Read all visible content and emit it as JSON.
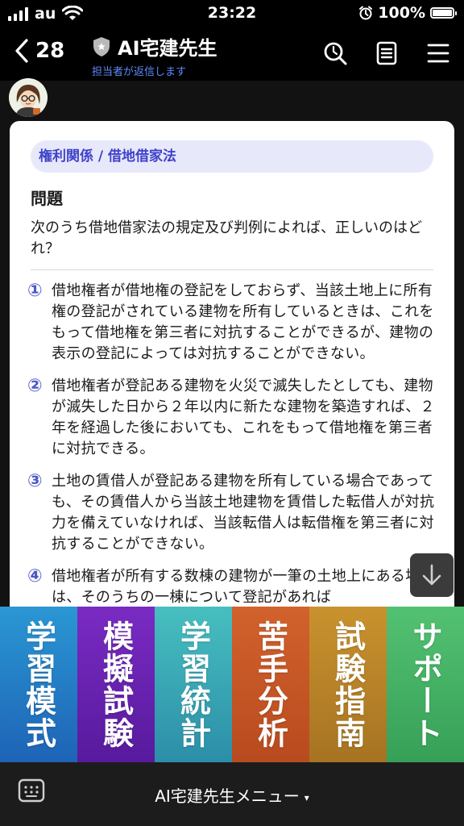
{
  "status_bar": {
    "carrier": "au",
    "time": "23:22",
    "battery": "100%"
  },
  "header": {
    "back_count": "28",
    "title": "AI宅建先生",
    "subtitle": "担当者が返信します"
  },
  "card": {
    "category": "権利関係 / 借地借家法",
    "question_heading": "問題",
    "question_text": "次のうち借地借家法の規定及び判例によれば、正しいのはどれ？",
    "options": [
      {
        "number": "①",
        "text": "借地権者が借地権の登記をしておらず、当該土地上に所有権の登記がされている建物を所有しているときは、これをもって借地権を第三者に対抗することができるが、建物の表示の登記によっては対抗することができない。"
      },
      {
        "number": "②",
        "text": "借地権者が登記ある建物を火災で滅失したとしても、建物が滅失した日から２年以内に新たな建物を築造すれば、２年を経過した後においても、これをもって借地権を第三者に対抗できる。"
      },
      {
        "number": "③",
        "text": "土地の賃借人が登記ある建物を所有している場合であっても、その賃借人から当該土地建物を賃借した転借人が対抗力を備えていなければ、当該転借人は転借権を第三者に対抗することができない。"
      },
      {
        "number": "④",
        "text": "借地権者が所有する数棟の建物が一筆の土地上にある場合は、そのうちの一棟について登記があれば"
      }
    ]
  },
  "menu_tiles": [
    {
      "label": "学習模式"
    },
    {
      "label": "模擬試験"
    },
    {
      "label": "学習統計"
    },
    {
      "label": "苦手分析"
    },
    {
      "label": "試験指南"
    },
    {
      "label": "サポート"
    }
  ],
  "bottom_bar": {
    "menu_label": "AI宅建先生メニュー",
    "caret": "▾"
  }
}
